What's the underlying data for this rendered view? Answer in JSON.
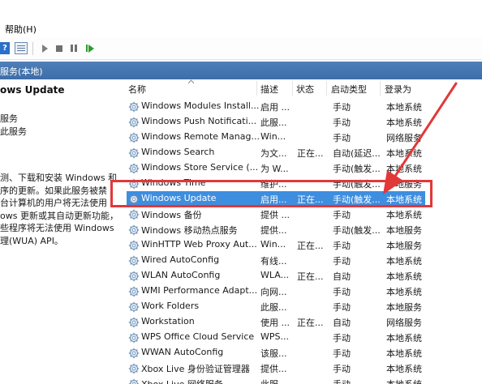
{
  "menubar": {
    "help_label": "帮助(H)"
  },
  "toolbar": {
    "help_glyph": "?",
    "buttons": [
      "help-icon",
      "properties-icon",
      "start-icon",
      "stop-icon",
      "pause-icon",
      "restart-icon"
    ]
  },
  "panel": {
    "title": "服务(本地)"
  },
  "left": {
    "service_title": "ows Update",
    "link1": "服务",
    "link2": "此服务",
    "description": "测、下载和安装 Windows 和\n序的更新。如果此服务被禁\n台计算机的用户将无法使用\nows 更新或其自动更新功能，\n些程序将无法使用 Windows\n理(WUA) API。"
  },
  "columns": {
    "name": "名称",
    "desc": "描述",
    "status": "状态",
    "startup": "启动类型",
    "logon": "登录为"
  },
  "services": [
    {
      "name": "Windows Modules Install...",
      "desc": "启用 ...",
      "status": "",
      "startup": "手动",
      "logon": "本地系统"
    },
    {
      "name": "Windows Push Notificati...",
      "desc": "此服...",
      "status": "",
      "startup": "手动",
      "logon": "本地系统"
    },
    {
      "name": "Windows Remote Manag...",
      "desc": "Win...",
      "status": "",
      "startup": "手动",
      "logon": "网络服务"
    },
    {
      "name": "Windows Search",
      "desc": "为文...",
      "status": "正在...",
      "startup": "自动(延迟...",
      "logon": "本地系统"
    },
    {
      "name": "Windows Store Service (...",
      "desc": "为 W...",
      "status": "",
      "startup": "手动(触发...",
      "logon": "本地系统"
    },
    {
      "name": "Windows Time",
      "desc": "维护...",
      "status": "",
      "startup": "手动(触发...",
      "logon": "本地服务"
    },
    {
      "name": "Windows Update",
      "desc": "启用...",
      "status": "正在...",
      "startup": "手动(触发...",
      "logon": "本地系统"
    },
    {
      "name": "Windows 备份",
      "desc": "提供 ...",
      "status": "",
      "startup": "手动",
      "logon": "本地系统"
    },
    {
      "name": "Windows 移动热点服务",
      "desc": "提供...",
      "status": "",
      "startup": "手动(触发...",
      "logon": "本地服务"
    },
    {
      "name": "WinHTTP Web Proxy Aut...",
      "desc": "Win...",
      "status": "正在...",
      "startup": "手动",
      "logon": "本地服务"
    },
    {
      "name": "Wired AutoConfig",
      "desc": "有线...",
      "status": "",
      "startup": "手动",
      "logon": "本地系统"
    },
    {
      "name": "WLAN AutoConfig",
      "desc": "WLA...",
      "status": "正在...",
      "startup": "自动",
      "logon": "本地系统"
    },
    {
      "name": "WMI Performance Adapt...",
      "desc": "向网...",
      "status": "",
      "startup": "手动",
      "logon": "本地系统"
    },
    {
      "name": "Work Folders",
      "desc": "此服...",
      "status": "",
      "startup": "手动",
      "logon": "本地服务"
    },
    {
      "name": "Workstation",
      "desc": "使用 ...",
      "status": "正在...",
      "startup": "自动",
      "logon": "网络服务"
    },
    {
      "name": "WPS Office Cloud Service",
      "desc": "WPS...",
      "status": "",
      "startup": "手动",
      "logon": "本地系统"
    },
    {
      "name": "WWAN AutoConfig",
      "desc": "该服...",
      "status": "",
      "startup": "手动",
      "logon": "本地系统"
    },
    {
      "name": "Xbox Live 身份验证管理器",
      "desc": "提供...",
      "status": "",
      "startup": "手动",
      "logon": "本地系统"
    },
    {
      "name": "Xbox Live 网络服务",
      "desc": "此服...",
      "status": "",
      "startup": "手动",
      "logon": "本地系统"
    }
  ],
  "selected_index": 6,
  "colors": {
    "selection": "#3e8ee0",
    "annotation": "#e23838",
    "header": "#4f7fb8"
  },
  "icons": {
    "service": "gear-icon"
  }
}
